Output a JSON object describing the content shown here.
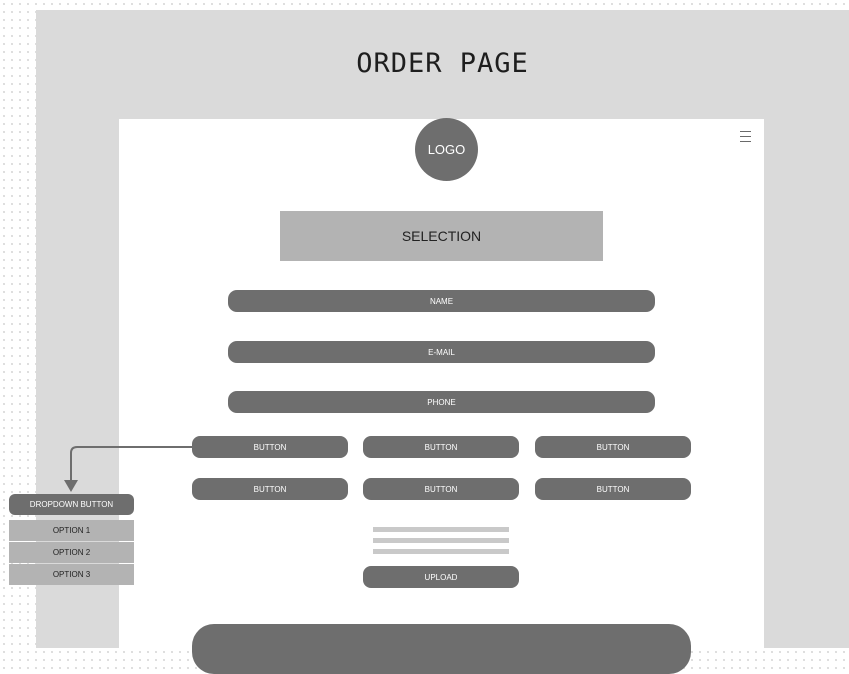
{
  "page": {
    "title": "ORDER PAGE"
  },
  "header": {
    "logo_text": "LOGO",
    "menu_icon": "hamburger-menu-icon"
  },
  "selection": {
    "label": "SELECTION"
  },
  "form": {
    "name_label": "NAME",
    "email_label": "E-MAIL",
    "phone_label": "PHONE"
  },
  "buttons": [
    "BUTTON",
    "BUTTON",
    "BUTTON",
    "BUTTON",
    "BUTTON",
    "BUTTON"
  ],
  "upload": {
    "label": "UPLOAD"
  },
  "dropdown": {
    "button_label": "DROPDOWN BUTTON",
    "options": [
      "OPTION 1",
      "OPTION 2",
      "OPTION 3"
    ]
  },
  "colors": {
    "frame": "#dadada",
    "card": "#ffffff",
    "element_dark": "#6e6e6e",
    "element_light": "#b3b3b3"
  }
}
